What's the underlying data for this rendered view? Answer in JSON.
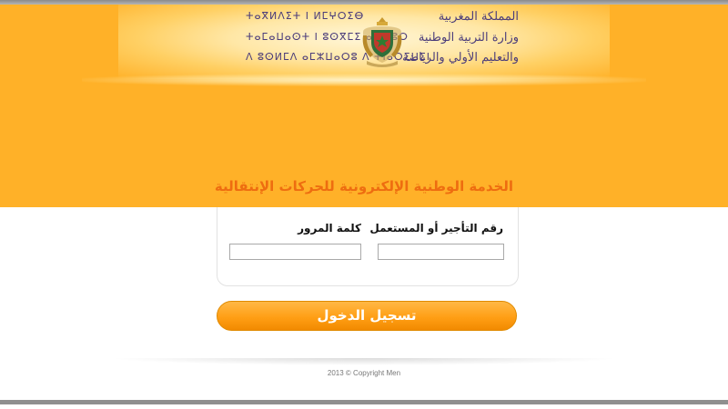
{
  "header": {
    "arabic_lines": [
      "المملكة المغربية",
      "وزارة التربية الوطنية",
      "والتعليم الأولي والرياضة"
    ],
    "tifinagh_lines": [
      "ⵜⴰⴳⵍⴷⵉⵜ ⵏ ⵍⵎⵖⵔⵉⴱ",
      "ⵜⴰⵎⴰⵡⴰⵙⵜ ⵏ ⵓⵙⴳⵎⵉ ⴰⵏⴰⵎⵓⵔ",
      "ⴷ ⵓⵙⵍⵎⴷ ⴰⵎⵣⵡⴰⵔⵓ ⴷ ⵜⵏⴰⵔⵉⵡⵉⵏ"
    ],
    "emblem_icon": "royal-coat-of-arms-icon"
  },
  "service_title": "الخدمة الوطنية الإلكترونية للحركات الإنتقالية",
  "form": {
    "username_label": "رقم التأجير أو المستعمل",
    "username_value": "",
    "username_placeholder": "",
    "password_label": "كلمة المرور",
    "password_value": "",
    "password_placeholder": ""
  },
  "login_button_label": "تسجيل الدخول",
  "footer": {
    "copyright": "2013 © Copyright Men"
  },
  "colors": {
    "header_bg": "#ffb128",
    "title_color": "#ee6d10",
    "button_color": "#ff9f15"
  }
}
